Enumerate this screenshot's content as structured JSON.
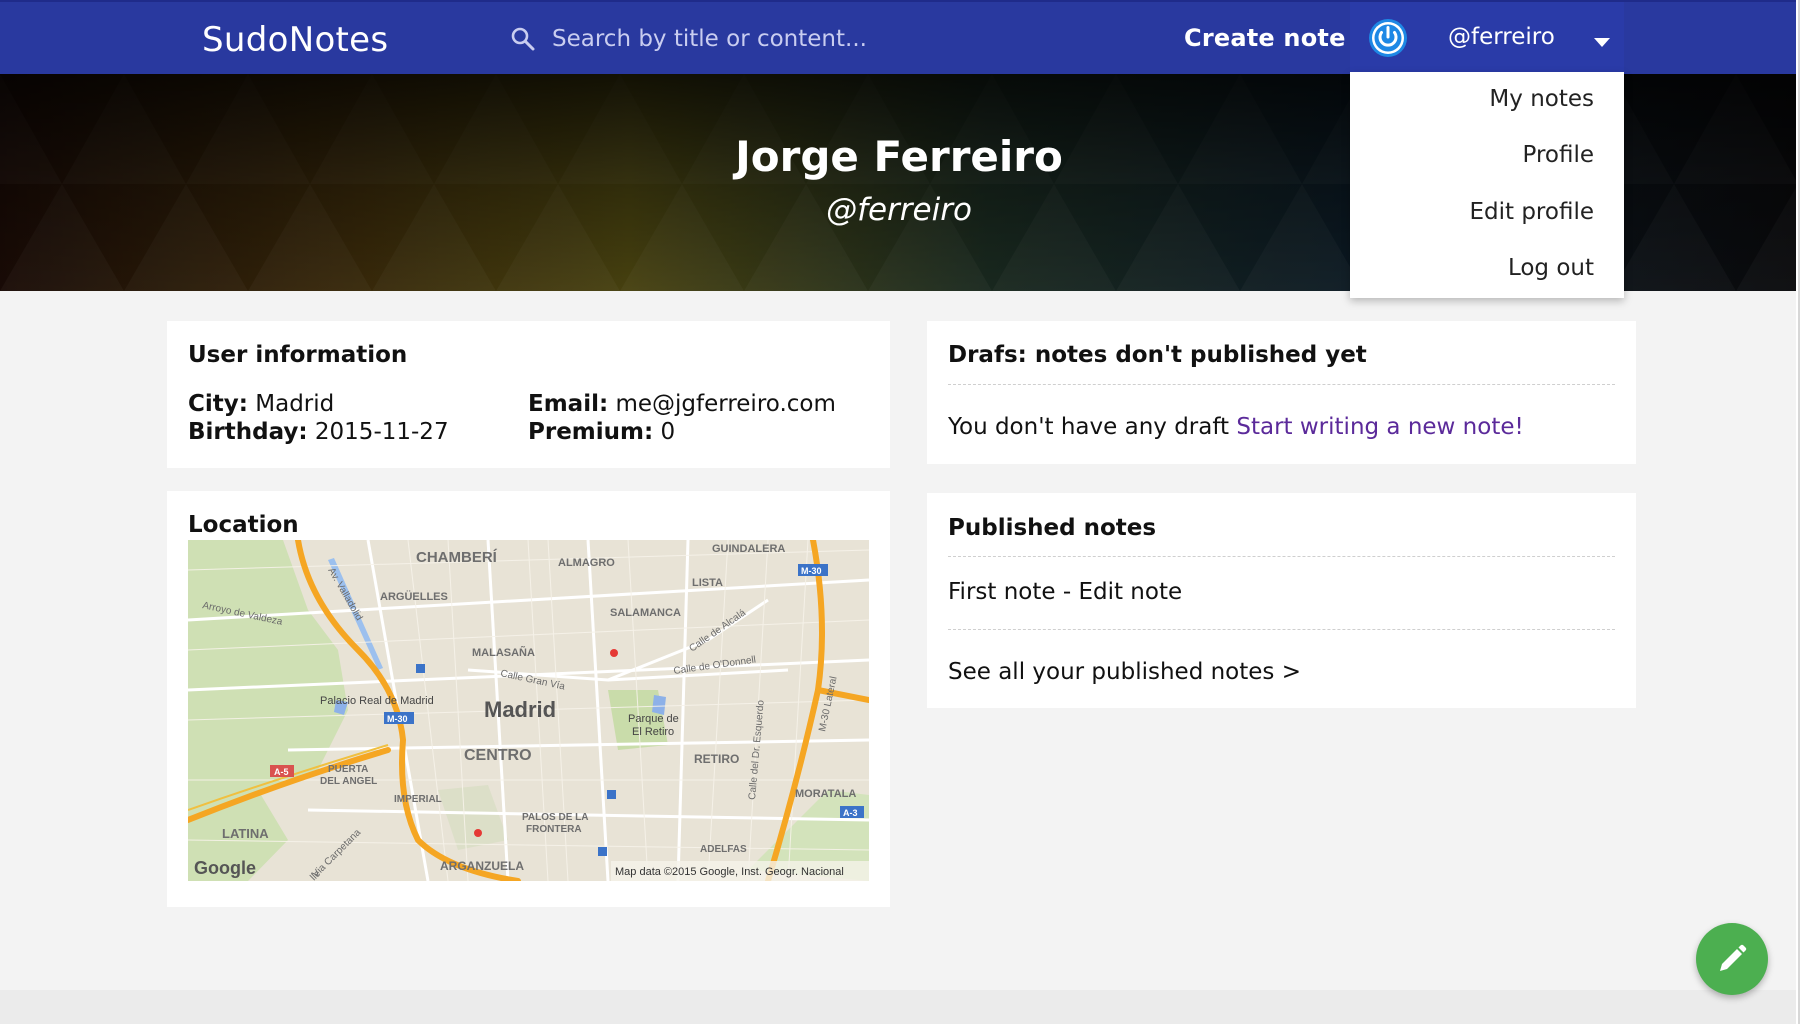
{
  "header": {
    "brand": "SudoNotes",
    "search_placeholder": "Search by title or content...",
    "create_note": "Create note",
    "username": "@ferreiro"
  },
  "user_menu": {
    "items": [
      "My notes",
      "Profile",
      "Edit profile",
      "Log out"
    ]
  },
  "profile": {
    "name": "Jorge Ferreiro",
    "handle": "@ferreiro"
  },
  "user_information": {
    "title": "User information",
    "city_label": "City:",
    "city": "Madrid",
    "birthday_label": "Birthday:",
    "birthday": "2015-11-27",
    "email_label": "Email:",
    "email": "me@jgferreiro.com",
    "premium_label": "Premium:",
    "premium": "0"
  },
  "location": {
    "title": "Location",
    "map_labels": {
      "chamberi": "CHAMBERÍ",
      "almagro": "ALMAGRO",
      "guindalera": "GUINDALERA",
      "lista": "LISTA",
      "arguelles": "ARGÜELLES",
      "salamanca": "SALAMANCA",
      "malasana": "MALASAÑA",
      "madrid": "Madrid",
      "centro": "CENTRO",
      "retiro": "RETIRO",
      "palacio": "Palacio Real de Madrid",
      "parque": "Parque de",
      "parque2": "El Retiro",
      "puerta": "PUERTA",
      "puerta2": "DEL ANGEL",
      "imperial": "IMPERIAL",
      "palos": "PALOS DE LA",
      "palos2": "FRONTERA",
      "latina": "LATINA",
      "arganzuela": "ARGANZUELA",
      "adelfas": "ADELFAS",
      "moratala": "MORATALA",
      "arroyo": "Arroyo de Valdeza",
      "valladolid": "Av. Valladolid",
      "granvia": "Calle Gran Vía",
      "alcala": "Calle de Alcalá",
      "odonnell": "Calle de O'Donnell",
      "esquerdo": "Calle del Dr. Esquerdo",
      "m30lateral": "M-30 Lateral",
      "carpetana": "Via Carpetana",
      "vialle": "lle",
      "m30a": "M-30",
      "m30b": "M-30",
      "a5": "A-5",
      "a3": "A-3",
      "google": "Google",
      "attribution": "Map data ©2015 Google, Inst. Geogr. Nacional"
    }
  },
  "drafts": {
    "title": "Drafs: notes don't published yet",
    "empty_text": "You don't have any draft",
    "cta": "Start writing a new note!"
  },
  "published": {
    "title": "Published notes",
    "note": "First note - Edit note",
    "see_all": "See all your published notes >"
  },
  "colors": {
    "primary": "#29399f",
    "link": "#5b2a9a",
    "fab": "#4caf50"
  }
}
